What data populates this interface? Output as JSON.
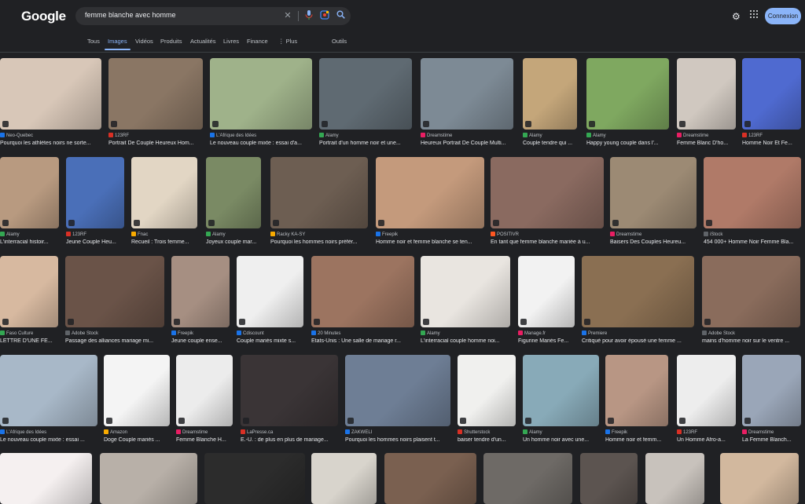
{
  "header": {
    "logo": "Google",
    "query": "femme blanche avec homme",
    "signin_label": "Connexion",
    "icons": [
      "clear-icon",
      "microphone-icon",
      "lens-icon",
      "search-icon",
      "gear-icon",
      "apps-grid-icon"
    ]
  },
  "tabs": [
    {
      "label": "Tous",
      "active": false
    },
    {
      "label": "Images",
      "active": true
    },
    {
      "label": "Vidéos",
      "active": false
    },
    {
      "label": "Produits",
      "active": false
    },
    {
      "label": "Actualités",
      "active": false
    },
    {
      "label": "Livres",
      "active": false
    },
    {
      "label": "Finance",
      "active": false
    },
    {
      "label": "⋮ Plus",
      "active": false
    },
    {
      "label": "Outils",
      "active": false
    }
  ],
  "results": [
    [
      {
        "source": "Neo-Quebec",
        "title": "Pourquoi les athlètes noirs ne sorte...",
        "color": "#d8c7b8",
        "icon": "#1a73e8"
      },
      {
        "source": "123RF",
        "title": "Portrait De Couple Heureux Hom...",
        "color": "#8a7664",
        "icon": "#d93025"
      },
      {
        "source": "L'Afrique des Idées",
        "title": "Le nouveau couple mixte : essai d'a...",
        "color": "#9fb28a",
        "icon": "#1a73e8"
      },
      {
        "source": "Alamy",
        "title": "Portrait d'un homme noir et une...",
        "color": "#5f6a72",
        "icon": "#34a853"
      },
      {
        "source": "Dreamstime",
        "title": "Heureux Portrait De Couple Multi...",
        "color": "#7d8a95",
        "icon": "#e91e63"
      },
      {
        "source": "Alamy",
        "title": "Couple tendre qui ...",
        "color": "#c4a67a",
        "icon": "#34a853"
      },
      {
        "source": "Alamy",
        "title": "Happy young couple dans l'...",
        "color": "#7fa860",
        "icon": "#34a853"
      },
      {
        "source": "Dreamstime",
        "title": "Femme Blanc D'ho...",
        "color": "#d0c8c0",
        "icon": "#e91e63"
      },
      {
        "source": "123RF",
        "title": "Homme Noir Et Fe...",
        "color": "#4f6ad0",
        "icon": "#d93025"
      }
    ],
    [
      {
        "source": "Alamy",
        "title": "L'interracial histoir...",
        "color": "#b89a80",
        "icon": "#34a853"
      },
      {
        "source": "123RF",
        "title": "Jeune Couple Heu...",
        "color": "#4a6fb8",
        "icon": "#d93025"
      },
      {
        "source": "Fnac",
        "title": "Recueil : Trois femme...",
        "color": "#e2d6c4",
        "icon": "#f9ab00"
      },
      {
        "source": "Alamy",
        "title": "Joyeux couple mar...",
        "color": "#7a8a64",
        "icon": "#34a853"
      },
      {
        "source": "Racky KA-SY",
        "title": "Pourquoi les hommes noirs préfèr...",
        "color": "#6d5e52",
        "icon": "#f9ab00"
      },
      {
        "source": "Freepik",
        "title": "Homme noir et femme blanche se ten...",
        "color": "#c49a7c",
        "icon": "#1a73e8"
      },
      {
        "source": "POSITIVR",
        "title": "En tant que femme blanche mariée à u...",
        "color": "#8a6a60",
        "icon": "#ff5722"
      },
      {
        "source": "Dreamstime",
        "title": "Baisers Des Couples Heureu...",
        "color": "#9c8a74",
        "icon": "#e91e63"
      },
      {
        "source": "iStock",
        "title": "454 000+ Homme Noir Femme Bla...",
        "color": "#b07a68",
        "icon": "#5f6368"
      }
    ],
    [
      {
        "source": "Faso Culture",
        "title": "LETTRE D'UNE FE...",
        "color": "#d7b9a0",
        "icon": "#34a853"
      },
      {
        "source": "Adobe Stock",
        "title": "Passage des alliances mariage mi...",
        "color": "#6a5348",
        "icon": "#5f6368"
      },
      {
        "source": "Freepik",
        "title": "Jeune couple ense...",
        "color": "#a68f82",
        "icon": "#1a73e8"
      },
      {
        "source": "Cdiscount",
        "title": "Couple mariés mixte s...",
        "color": "#efefef",
        "icon": "#1a73e8"
      },
      {
        "source": "20 Minutes",
        "title": "Etats-Unis : Une salle de mariage r...",
        "color": "#9c7460",
        "icon": "#1a73e8"
      },
      {
        "source": "Alamy",
        "title": "L'interracial couple homme noi...",
        "color": "#e9e5e0",
        "icon": "#34a853"
      },
      {
        "source": "Manage.fr",
        "title": "Figurine Mariés Fe...",
        "color": "#f2f2f2",
        "icon": "#e91e63"
      },
      {
        "source": "Premiere",
        "title": "Critiqué pour avoir épousé une femme ...",
        "color": "#8a6f52",
        "icon": "#1a73e8"
      },
      {
        "source": "Adobe Stock",
        "title": "mains d'homme noir sur le ventre ...",
        "color": "#8a6c5c",
        "icon": "#5f6368"
      }
    ],
    [
      {
        "source": "L'Afrique des Idées",
        "title": "Le nouveau couple mixte : essai ...",
        "color": "#a8b8c8",
        "icon": "#1a73e8"
      },
      {
        "source": "Amazon",
        "title": "Doge Couple mariés ...",
        "color": "#f4f4f4",
        "icon": "#f9ab00"
      },
      {
        "source": "Dreamstime",
        "title": "Femme Blanche H...",
        "color": "#ececec",
        "icon": "#e91e63"
      },
      {
        "source": "LaPresse.ca",
        "title": "É.-U. : de plus en plus de mariage...",
        "color": "#3a3436",
        "icon": "#d93025"
      },
      {
        "source": "ZAKWELI",
        "title": "Pourquoi les hommes noirs plaisent t...",
        "color": "#6e7e95",
        "icon": "#1a73e8"
      },
      {
        "source": "Shutterstock",
        "title": "baiser tendre d'un...",
        "color": "#f0f0ee",
        "icon": "#d93025"
      },
      {
        "source": "Alamy",
        "title": "Un homme noir avec une...",
        "color": "#88aab8",
        "icon": "#34a853"
      },
      {
        "source": "Freepik",
        "title": "Homme noir et femm...",
        "color": "#b89684",
        "icon": "#1a73e8"
      },
      {
        "source": "123RF",
        "title": "Un Homme Afro-a...",
        "color": "#ededed",
        "icon": "#d93025"
      },
      {
        "source": "Dreamstime",
        "title": "La Femme Blanch...",
        "color": "#9aa6b8",
        "icon": "#e91e63"
      }
    ],
    [
      {
        "color": "#f5f0f0"
      },
      {
        "color": "#b8b0a8"
      },
      {
        "color": "#2c2c2c"
      },
      {
        "color": "#d8d4cc"
      },
      {
        "color": "#7a6050"
      },
      {
        "color": "#6e6a66"
      },
      {
        "color": "#5c5450"
      },
      {
        "color": "#c8c2bc"
      },
      {
        "color": "#d2b89e"
      }
    ]
  ]
}
